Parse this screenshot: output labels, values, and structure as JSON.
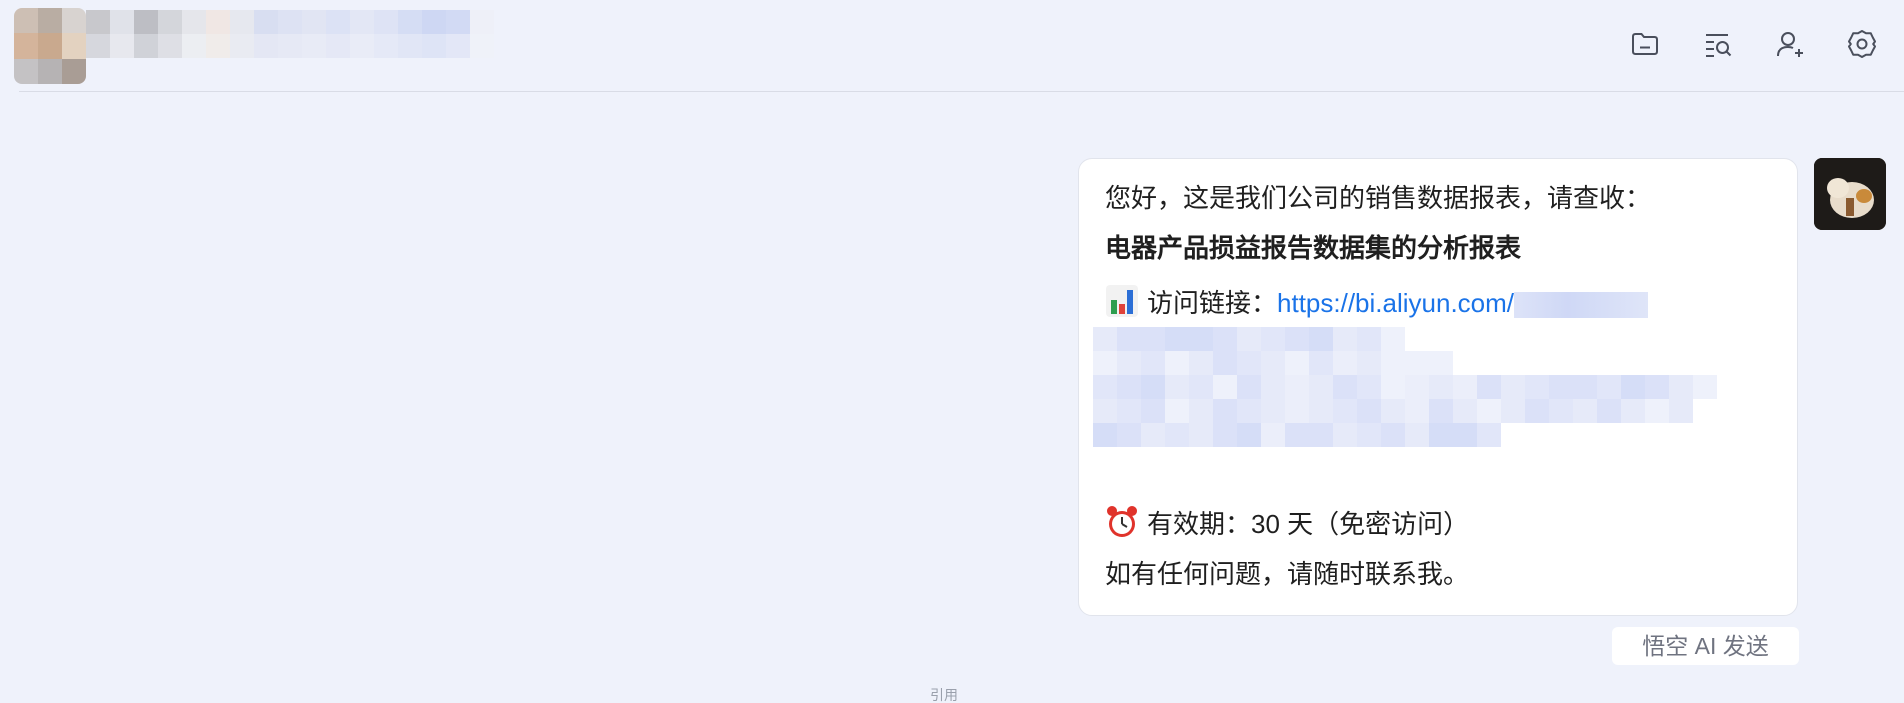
{
  "header": {
    "icons": [
      {
        "name": "folder-icon"
      },
      {
        "name": "search-list-icon"
      },
      {
        "name": "add-member-icon"
      },
      {
        "name": "settings-icon"
      }
    ]
  },
  "message": {
    "greeting": "您好，这是我们公司的销售数据报表，请查收：",
    "report_title": "电器产品损益报告数据集的分析报表",
    "link_label": "访问链接：",
    "link_url": "https://bi.aliyun.com/",
    "validity": "有效期：30 天（免密访问）",
    "closing": "如有任何问题，请随时联系我。",
    "chart_emoji_name": "bar-chart-emoji",
    "clock_emoji_name": "alarm-clock-emoji"
  },
  "sender_tag": "悟空 AI 发送",
  "bottom_partial": "引用",
  "colors": {
    "background": "#eff2fb",
    "bubble": "#ffffff",
    "link": "#1a73e8"
  }
}
